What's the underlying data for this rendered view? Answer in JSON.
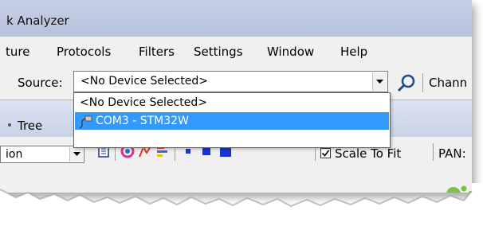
{
  "window": {
    "title": "k Analyzer"
  },
  "menu": {
    "items": [
      "ture",
      "Protocols",
      "Filters",
      "Settings",
      "Window",
      "Help"
    ]
  },
  "toolbar": {
    "source_label": "Source:",
    "source_value": "<No Device Selected>",
    "channel_label": "Chann"
  },
  "dropdown": {
    "options": [
      "<No Device Selected>",
      "COM3 - STM32W"
    ],
    "highlighted": "COM3 - STM32W"
  },
  "panel": {
    "title": "Tree"
  },
  "view_toolbar": {
    "combo_value": "ion",
    "scale_label": "Scale To Fit",
    "scale_checked": true,
    "pan_label": "PAN:"
  },
  "colors": {
    "selection": "#3399ff",
    "titlebar": "#c3cce3",
    "logo": "#7cc242"
  },
  "icons": [
    "chevron-down-icon",
    "search-icon",
    "usb-plug-icon",
    "document-icon",
    "color-wheel-icon",
    "graph-icon",
    "bars-icon",
    "square-small-icon",
    "square-medium-icon",
    "square-large-icon",
    "checkmark-icon",
    "logo-dots-icon"
  ]
}
